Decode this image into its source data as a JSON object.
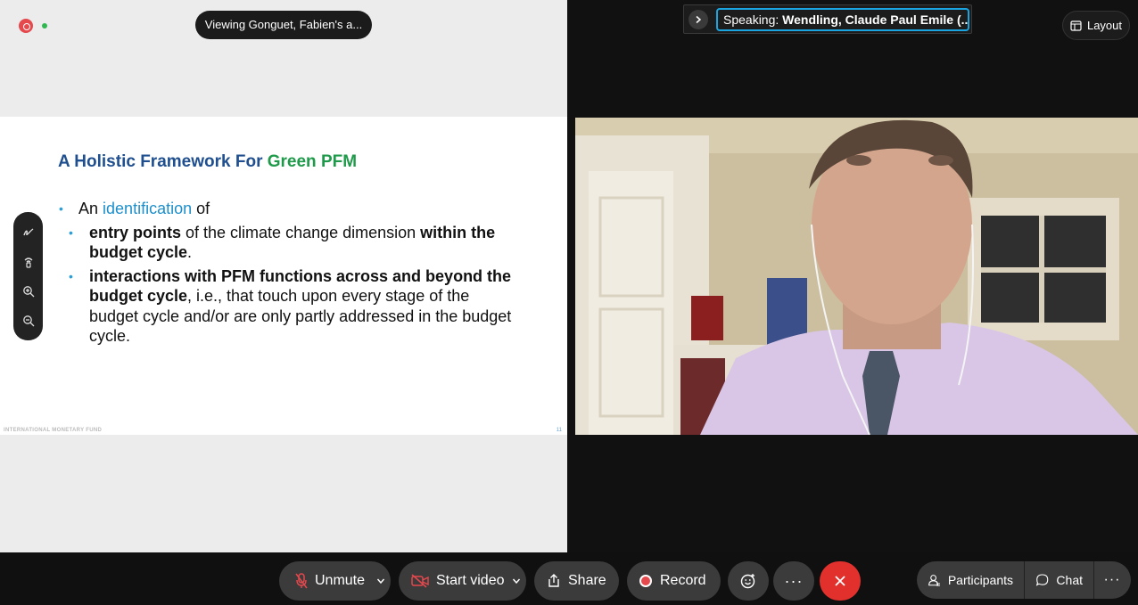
{
  "share": {
    "viewing_label": "Viewing Gonguet, Fabien's a...",
    "slide": {
      "title_part1": "A Holistic Framework For ",
      "title_part2": "Green PFM",
      "bullet1_prefix": "An ",
      "bullet1_accent": "identification",
      "bullet1_suffix": " of",
      "sub1_bold1": "entry points",
      "sub1_text": " of the climate change dimension ",
      "sub1_bold2": "within the budget cycle",
      "sub1_end": ".",
      "sub2_bold": "interactions with PFM functions across and beyond the budget cycle",
      "sub2_text": ", i.e., that touch upon every stage of the budget cycle and/or are only partly addressed in the budget cycle.",
      "footer": "INTERNATIONAL MONETARY FUND",
      "page_number": "11"
    }
  },
  "header": {
    "speaking_prefix": "Speaking: ",
    "speaking_name": "Wendling, Claude Paul Emile (...",
    "layout_label": "Layout"
  },
  "toolbar": {
    "unmute_label": "Unmute",
    "start_video_label": "Start video",
    "share_label": "Share",
    "record_label": "Record",
    "participants_label": "Participants",
    "chat_label": "Chat"
  },
  "colors": {
    "accent_blue": "#1aa5e0",
    "end_red": "#e2312d",
    "record_red": "#e5484d",
    "title_blue": "#1f4f8f",
    "title_green": "#1f9a4a"
  }
}
